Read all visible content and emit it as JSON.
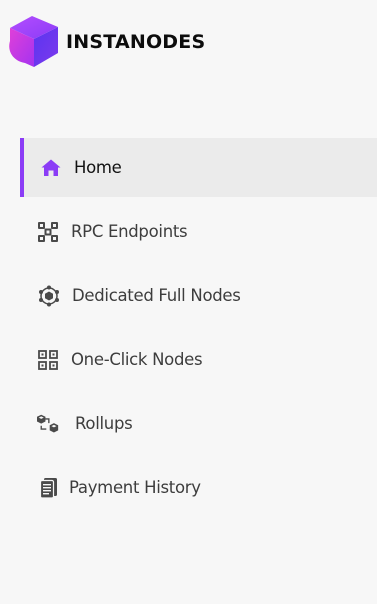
{
  "brand": {
    "name": "INSTANODES",
    "logo_icon": "gradient-cube-logo",
    "colors": {
      "logo_purple": "#8b3cf6",
      "logo_magenta": "#c026d3"
    }
  },
  "nav": {
    "accent_color": "#8b3cf6",
    "items": [
      {
        "label": "Home",
        "icon": "home-icon",
        "active": true
      },
      {
        "label": "RPC Endpoints",
        "icon": "rpc-network-icon",
        "active": false
      },
      {
        "label": "Dedicated Full Nodes",
        "icon": "node-cube-icon",
        "active": false
      },
      {
        "label": "One-Click Nodes",
        "icon": "one-click-grid-icon",
        "active": false
      },
      {
        "label": "Rollups",
        "icon": "rollups-cubes-icon",
        "active": false
      },
      {
        "label": "Payment History",
        "icon": "receipt-icon",
        "active": false
      }
    ]
  }
}
